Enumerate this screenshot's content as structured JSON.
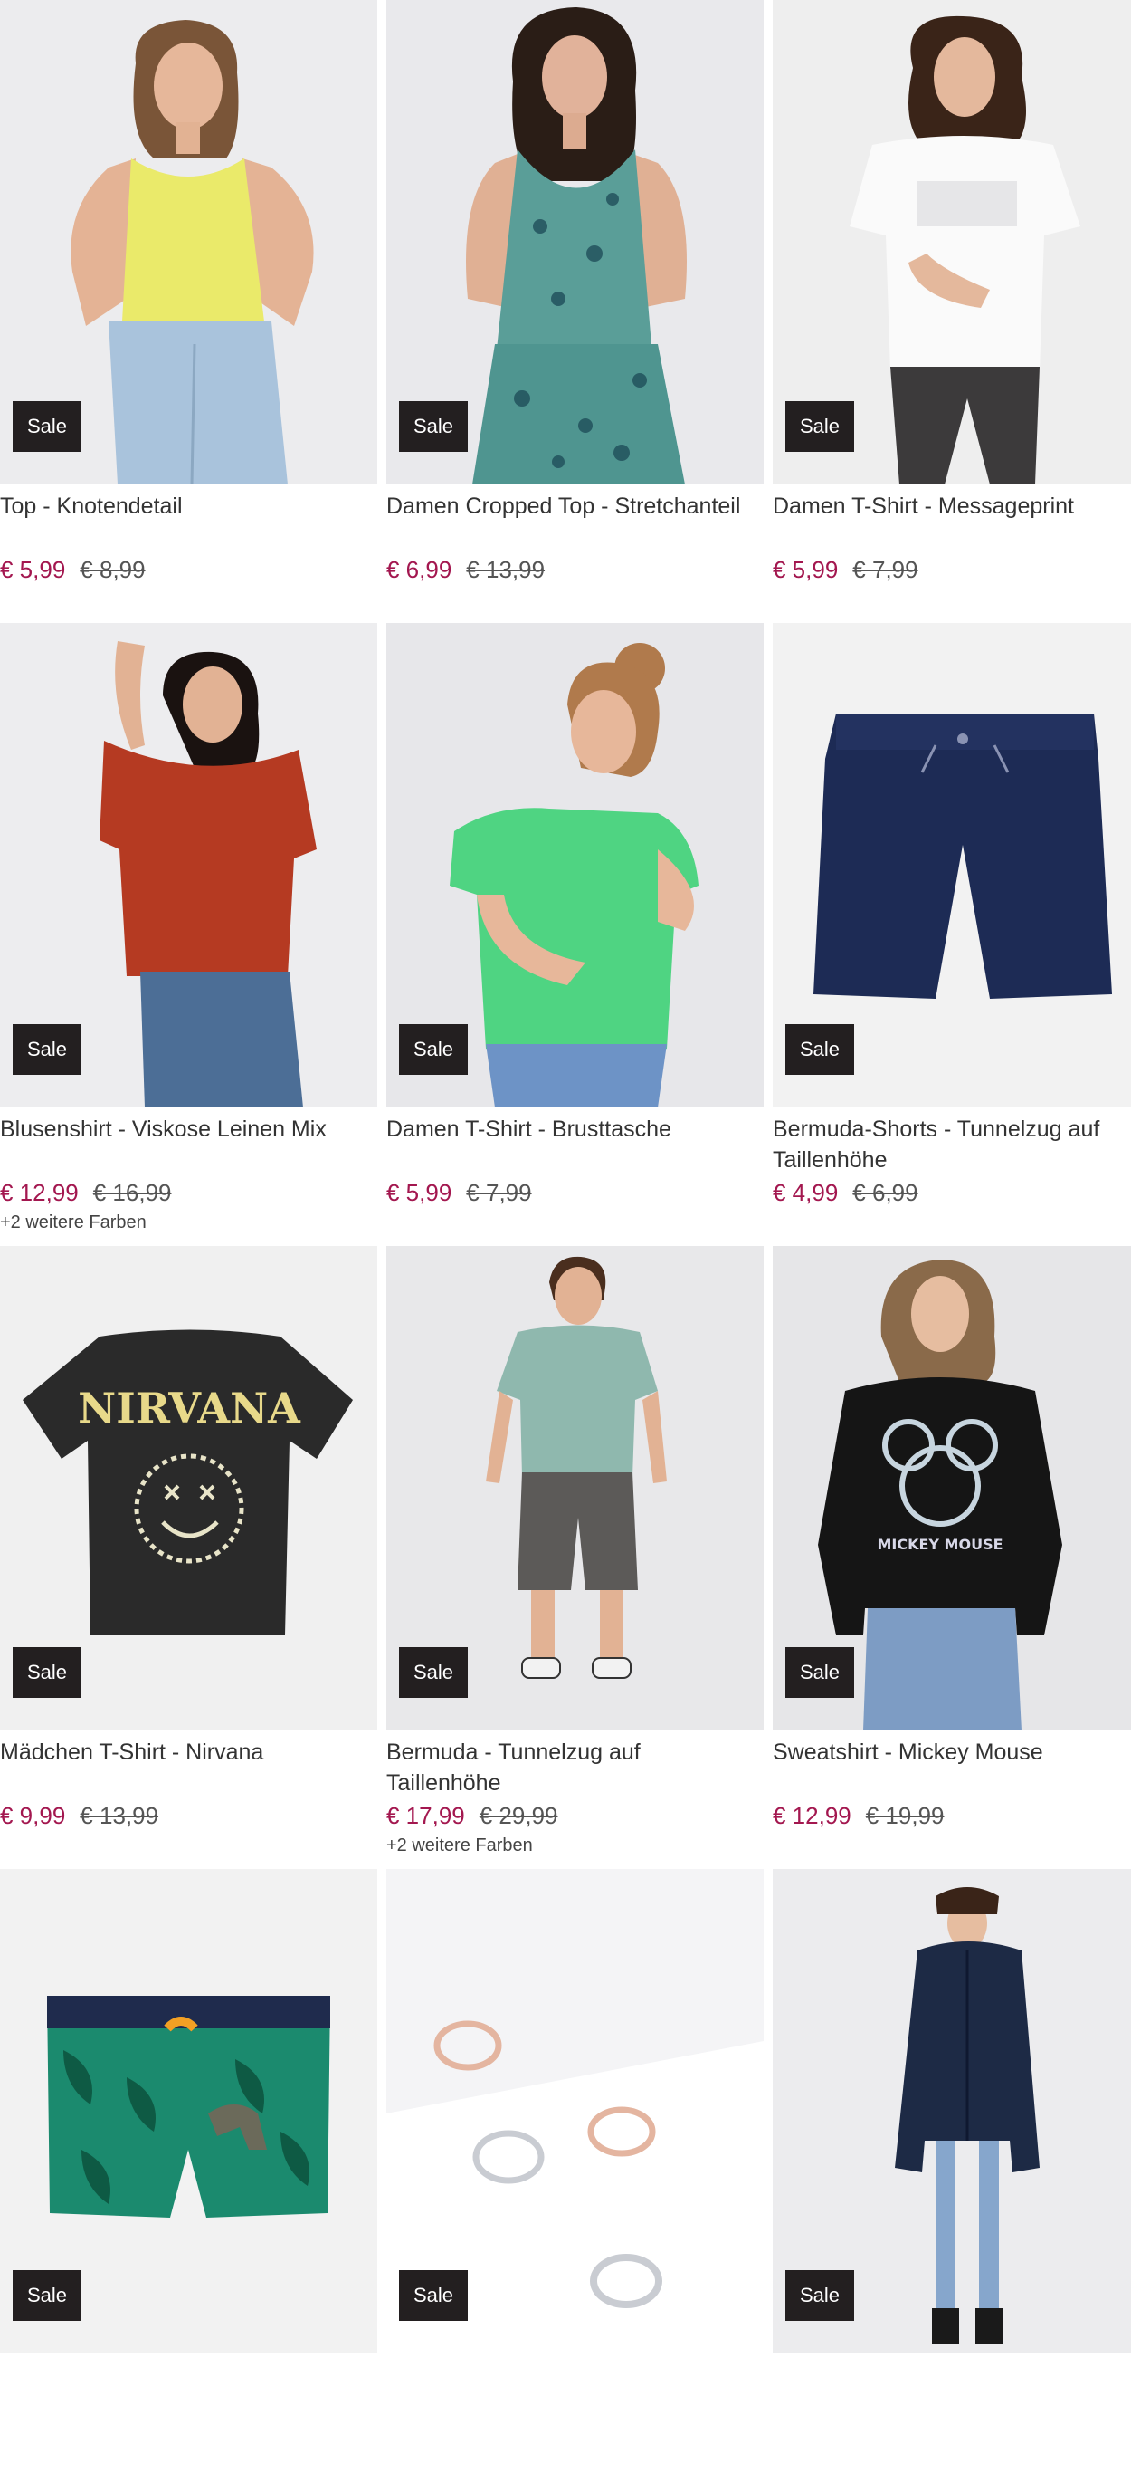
{
  "products": [
    {
      "name": "Top - Knotendetail",
      "badge": "Sale",
      "price": "€ 5,99",
      "old_price": "€ 8,99",
      "colors": "",
      "img_bg": "#ececee"
    },
    {
      "name": "Damen Cropped Top - Stretchanteil",
      "badge": "Sale",
      "price": "€ 6,99",
      "old_price": "€ 13,99",
      "colors": "",
      "img_bg": "#e9e9ec"
    },
    {
      "name": "Damen T-Shirt - Messageprint",
      "badge": "Sale",
      "price": "€ 5,99",
      "old_price": "€ 7,99",
      "colors": "",
      "img_bg": "#eeeeee"
    },
    {
      "name": "Blusenshirt - Viskose Leinen Mix",
      "badge": "Sale",
      "price": "€ 12,99",
      "old_price": "€ 16,99",
      "colors": "+2 weitere Farben",
      "img_bg": "#ededef"
    },
    {
      "name": "Damen T-Shirt - Brusttasche",
      "badge": "Sale",
      "price": "€ 5,99",
      "old_price": "€ 7,99",
      "colors": "",
      "img_bg": "#e7e7ea"
    },
    {
      "name": "Bermuda-Shorts - Tunnelzug auf Taillenhöhe",
      "badge": "Sale",
      "price": "€ 4,99",
      "old_price": "€ 6,99",
      "colors": "",
      "img_bg": "#f2f2f2"
    },
    {
      "name": "Mädchen T-Shirt - Nirvana",
      "badge": "Sale",
      "price": "€ 9,99",
      "old_price": "€ 13,99",
      "colors": "",
      "img_bg": "#f0f0f0"
    },
    {
      "name": "Bermuda - Tunnelzug auf Taillenhöhe",
      "badge": "Sale",
      "price": "€ 17,99",
      "old_price": "€ 29,99",
      "colors": "+2 weitere Farben",
      "img_bg": "#e8e8ea"
    },
    {
      "name": "Sweatshirt - Mickey Mouse",
      "badge": "Sale",
      "price": "€ 12,99",
      "old_price": "€ 19,99",
      "colors": "",
      "img_bg": "#e6e6e8"
    },
    {
      "name": "",
      "badge": "Sale",
      "price": "",
      "old_price": "",
      "colors": "",
      "img_bg": "#f2f2f2"
    },
    {
      "name": "",
      "badge": "Sale",
      "price": "",
      "old_price": "",
      "colors": "",
      "img_bg": "#f4f4f6"
    },
    {
      "name": "",
      "badge": "Sale",
      "price": "",
      "old_price": "",
      "colors": "",
      "img_bg": "#ececee"
    }
  ],
  "print_texts": {
    "nirvana": "NIRVANA",
    "mickey": "MICKEY MOUSE"
  },
  "colors": {
    "price_accent": "#a3174f",
    "badge_bg": "#231f20"
  }
}
